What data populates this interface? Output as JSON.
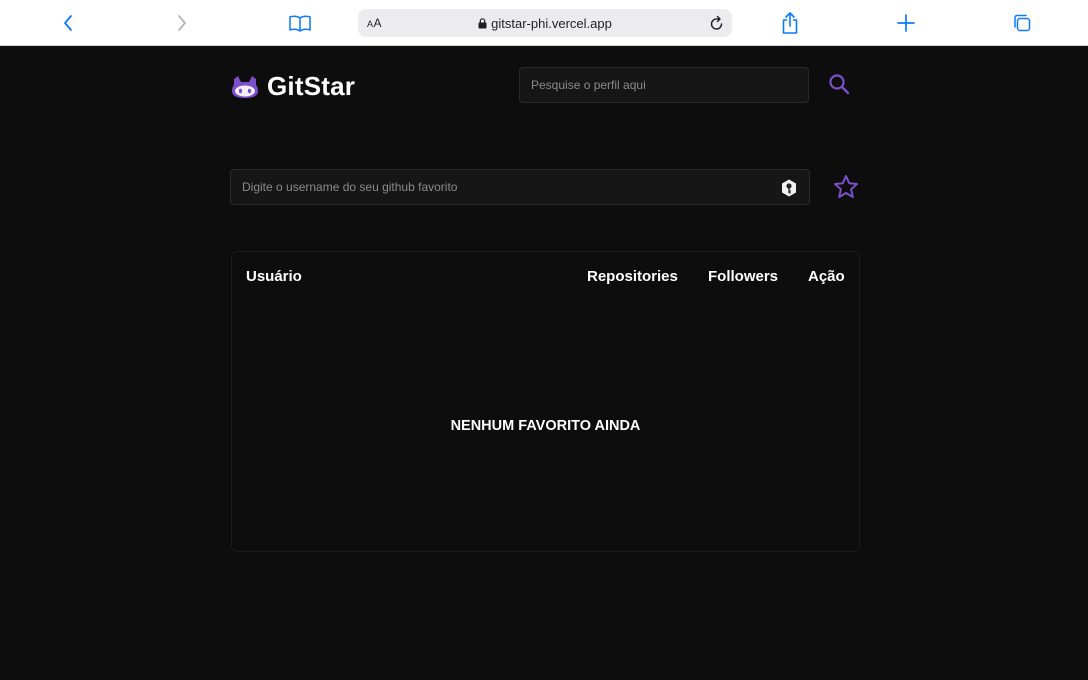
{
  "browser": {
    "text_size_label": "AA",
    "url": "gitstar-phi.vercel.app",
    "accent": "#0a7aff",
    "icons": [
      "back-icon",
      "forward-icon",
      "bookmarks-icon",
      "lock-icon",
      "reload-icon",
      "share-icon",
      "new-tab-icon",
      "tabs-icon"
    ]
  },
  "app": {
    "title": "GitStar",
    "brand_color": "#7b4fc9",
    "logo_icon": "github-cat-icon"
  },
  "header": {
    "search_placeholder": "Pesquise o perfil aqui",
    "search_value": "",
    "search_icon": "search-icon"
  },
  "favorite_form": {
    "placeholder": "Digite o username do seu github favorito",
    "value": "",
    "field_icon": "password-manager-icon",
    "submit_icon": "star-icon"
  },
  "table": {
    "columns": [
      "Usuário",
      "Repositories",
      "Followers",
      "Ação"
    ],
    "rows": [],
    "empty_message": "NENHUM FAVORITO AINDA"
  }
}
